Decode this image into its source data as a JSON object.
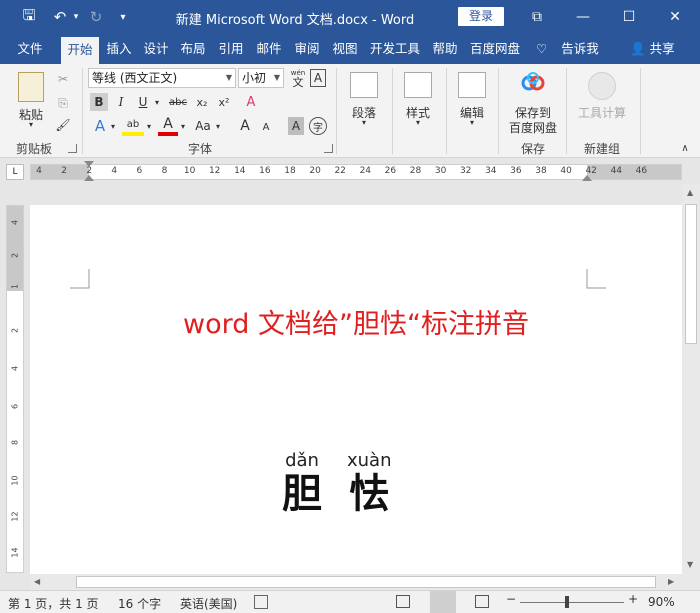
{
  "titlebar": {
    "title": "新建 Microsoft Word 文档.docx  -  Word",
    "login_label": "登录",
    "save_glyph": "🖫",
    "undo_glyph": "↶",
    "redo_glyph": "↻",
    "customize_glyph": "▾",
    "restore_glyph": "⧉",
    "minimize_glyph": "—",
    "maximize_glyph": "☐",
    "close_glyph": "✕"
  },
  "tabs": [
    "文件",
    "开始",
    "插入",
    "设计",
    "布局",
    "引用",
    "邮件",
    "审阅",
    "视图",
    "开发工具",
    "帮助",
    "百度网盘"
  ],
  "active_tab": "开始",
  "tellme": {
    "label": "告诉我",
    "icon": "lightbulb-icon",
    "glyph": "♡"
  },
  "share": {
    "label": "共享",
    "icon": "person-icon",
    "glyph": "👤"
  },
  "ribbon": {
    "clipboard": {
      "paste_label": "粘贴",
      "paste_arrow": "▾",
      "group_label": "剪贴板",
      "cut_glyph": "✂",
      "copy_glyph": "⎘",
      "painter_glyph": "🖌"
    },
    "font": {
      "font_name": "等线 (西文正文)",
      "font_size": "小初",
      "group_label": "字体",
      "bold": "B",
      "italic": "I",
      "underline": "U",
      "strike": "abc",
      "subscript": "x₂",
      "superscript": "x²",
      "text_effect": "A",
      "highlight": "ab",
      "font_color": "A",
      "change_case": "Aa",
      "grow": "A",
      "shrink": "A",
      "char_shading": "A",
      "enclose": "字",
      "pinyin_glyph": "wén",
      "pinyin_char": "文",
      "clear_glyph": "A",
      "border_glyph": "A"
    },
    "paragraph": {
      "label": "段落",
      "arrow": "▾"
    },
    "styles": {
      "label": "样式",
      "arrow": "▾"
    },
    "editing": {
      "label": "编辑",
      "arrow": "▾"
    },
    "baidu": {
      "line1": "保存到",
      "line2": "百度网盘",
      "group_label": "保存"
    },
    "newgroup": {
      "label": "工具计算",
      "group_label": "新建组"
    },
    "collapse_glyph": "∧"
  },
  "ruler": {
    "corner_glyph": "L",
    "ticks": [
      "4",
      "2",
      "2",
      "4",
      "6",
      "8",
      "10",
      "12",
      "14",
      "16",
      "18",
      "20",
      "22",
      "24",
      "26",
      "28",
      "30",
      "32",
      "34",
      "36",
      "38",
      "40",
      "42",
      "44",
      "46"
    ],
    "vticks": [
      "4",
      "2",
      "1",
      "2",
      "4",
      "6",
      "8",
      "10",
      "12",
      "14"
    ]
  },
  "document": {
    "title": "word 文档给”胆怯“标注拼音",
    "ruby": [
      {
        "pinyin": "dǎn",
        "hanzi": "胆"
      },
      {
        "pinyin": "xuàn",
        "hanzi": "怯"
      }
    ]
  },
  "statusbar": {
    "page": "第 1 页，共 1 页",
    "words": "16 个字",
    "language": "英语(美国)",
    "zoom_out": "−",
    "zoom_in": "+",
    "zoom": "90%",
    "zoom_level": 0.45
  },
  "colors": {
    "accent": "#2b579a",
    "title_red": "#e02020"
  }
}
